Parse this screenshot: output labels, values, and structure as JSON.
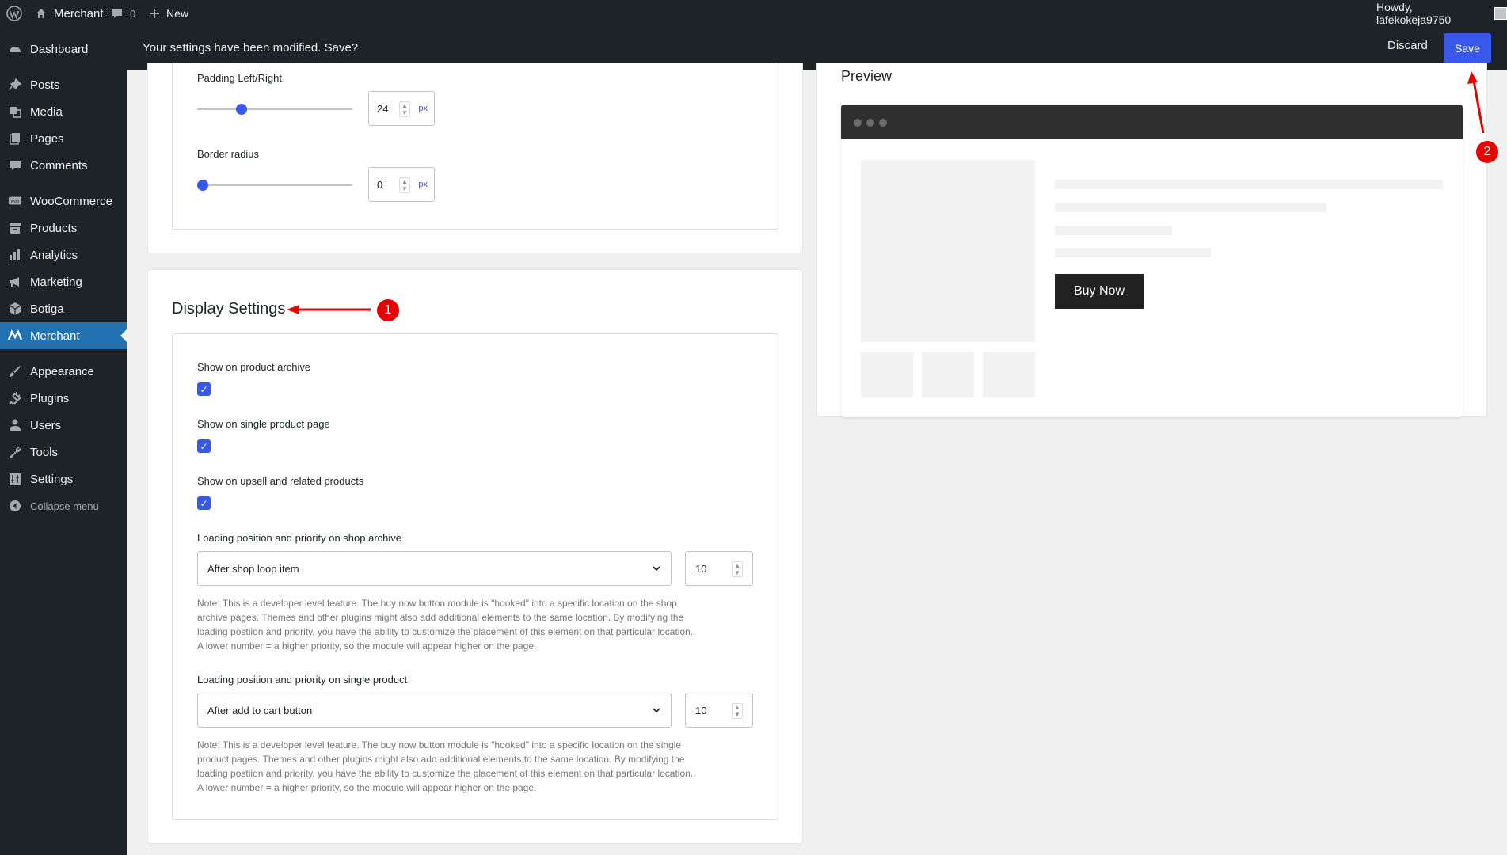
{
  "adminbar": {
    "site_name": "Merchant",
    "comments_count": "0",
    "new_label": "New",
    "howdy": "Howdy, lafekokeja9750"
  },
  "notice": {
    "text": "Your settings have been modified. Save?",
    "discard_label": "Discard",
    "save_label": "Save"
  },
  "sidebar": {
    "items": [
      {
        "label": "Dashboard",
        "icon": "dashboard-icon"
      },
      {
        "label": "Posts",
        "icon": "pin-icon"
      },
      {
        "label": "Media",
        "icon": "media-icon"
      },
      {
        "label": "Pages",
        "icon": "pages-icon"
      },
      {
        "label": "Comments",
        "icon": "comments-icon"
      },
      {
        "label": "WooCommerce",
        "icon": "woo-icon"
      },
      {
        "label": "Products",
        "icon": "archive-icon"
      },
      {
        "label": "Analytics",
        "icon": "bar-chart-icon"
      },
      {
        "label": "Marketing",
        "icon": "megaphone-icon"
      },
      {
        "label": "Botiga",
        "icon": "cube-icon"
      },
      {
        "label": "Merchant",
        "icon": "merchant-icon"
      },
      {
        "label": "Appearance",
        "icon": "brush-icon"
      },
      {
        "label": "Plugins",
        "icon": "plug-icon"
      },
      {
        "label": "Users",
        "icon": "user-icon"
      },
      {
        "label": "Tools",
        "icon": "wrench-icon"
      },
      {
        "label": "Settings",
        "icon": "sliders-icon"
      },
      {
        "label": "Collapse menu",
        "icon": "collapse-icon"
      }
    ],
    "active": "Merchant"
  },
  "style_panel": {
    "padding_label": "Padding Left/Right",
    "padding_value": "24",
    "padding_level": 0.25,
    "radius_label": "Border radius",
    "radius_value": "0",
    "radius_level": 0.0,
    "unit": "px"
  },
  "display": {
    "title": "Display Settings",
    "checks": [
      {
        "label": "Show on product archive",
        "checked": true
      },
      {
        "label": "Show on single product page",
        "checked": true
      },
      {
        "label": "Show on upsell and related products",
        "checked": true
      }
    ],
    "archive": {
      "label": "Loading position and priority on shop archive",
      "select": "After shop loop item",
      "priority": "10",
      "note_lines": [
        "Note: This is a developer level feature. The buy now button module is \"hooked\" into a specific location on the shop",
        "archive pages. Themes and other plugins might also add additional elements to the same location. By modifying the",
        "loading postiion and priority, you have the ability to customize the placement of this element on that particular location.",
        "A lower number = a higher priority, so the module will appear higher on the page."
      ]
    },
    "single": {
      "label": "Loading position and priority on single product",
      "select": "After add to cart button",
      "priority": "10",
      "note_lines": [
        "Note: This is a developer level feature. The buy now button module is \"hooked\" into a specific location on the single",
        "product pages. Themes and other plugins might also add additional elements to the same location. By modifying the",
        "loading postiion and priority, you have the ability to customize the placement of this element on that particular location.",
        "A lower number = a higher priority, so the module will appear higher on the page."
      ]
    }
  },
  "preview": {
    "title": "Preview",
    "buy_now_label": "Buy Now"
  },
  "annotations": {
    "badge_1": "1",
    "badge_2": "2",
    "color": "#e60000"
  },
  "colors": {
    "accent": "#3858e9",
    "admin_bg": "#1d2327",
    "active_menu": "#2271b1"
  }
}
